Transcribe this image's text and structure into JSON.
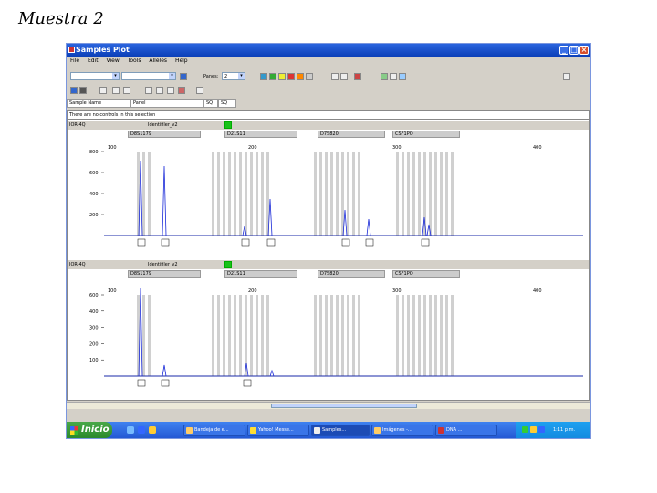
{
  "slide": {
    "title": "Muestra 2"
  },
  "window": {
    "title": "Samples Plot",
    "menu": [
      "File",
      "Edit",
      "View",
      "Tools",
      "Alleles",
      "Help"
    ],
    "toolbar": {
      "panes_label": "Panes:",
      "panes_value": "2"
    },
    "header_cells": [
      "Sample Name",
      "Panel",
      "SQ",
      "SQ"
    ],
    "notice": "There are no controls in this selection"
  },
  "panes": [
    {
      "sample": "IOR-4Q",
      "name_tag": "Identifiler_v2",
      "y_ticks": [
        "800",
        "600",
        "400",
        "200"
      ],
      "markers": [
        "D8S1179",
        "D21S11",
        "D7S820",
        "CSF1PO"
      ],
      "x_ticks": [
        "100",
        "200",
        "300",
        "400"
      ]
    },
    {
      "sample": "IOR-4Q",
      "name_tag": "Identifiler_v2",
      "y_ticks": [
        "600",
        "400",
        "300",
        "200",
        "100"
      ],
      "markers": [
        "D8S1179",
        "D21S11",
        "D7S820",
        "CSF1PO"
      ],
      "x_ticks": [
        "100",
        "200",
        "300",
        "400"
      ]
    }
  ],
  "taskbar": {
    "start_label": "Inicio",
    "tasks": [
      "Bandeja de e...",
      "Yahoo! Messe...",
      "Samples...",
      "Imágenes -...",
      "DNA ..."
    ],
    "clock": "1:11 p.m."
  }
}
